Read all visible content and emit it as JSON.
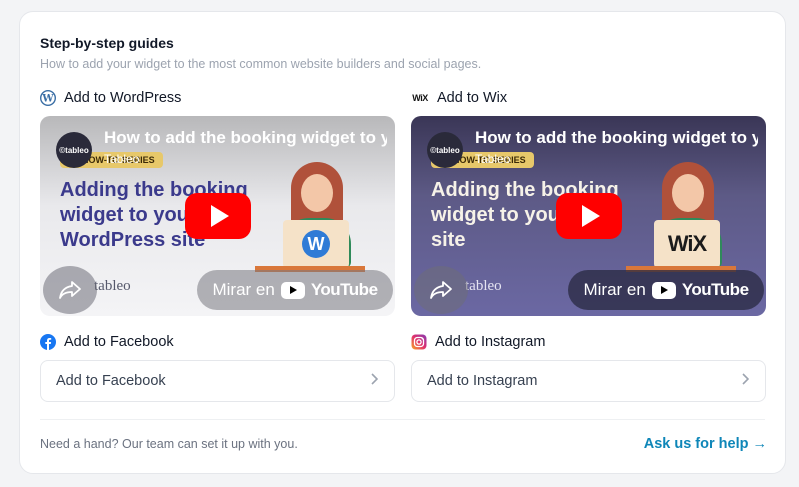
{
  "header": {
    "title": "Step-by-step guides",
    "subtitle": "How to add your widget to the most common website builders and social pages."
  },
  "guides": {
    "wordpress": {
      "label": "Add to WordPress",
      "icon": "wordpress-icon",
      "video": {
        "title": "How to add the booking widget to y",
        "channel": "Tableo",
        "channel_avatar_text": "©tableo",
        "series_badge": "HOW-TO SERIES",
        "headline": "Adding the booking widget to your WordPress site",
        "watermark": "tableo",
        "watch_label": "Mirar en",
        "youtube_word": "YouTube"
      }
    },
    "wix": {
      "label": "Add to Wix",
      "icon": "wix-icon",
      "icon_text": "WiX",
      "logo_text": "WiX",
      "video": {
        "title": "How to add the booking widget to y",
        "channel": "Tableo",
        "channel_avatar_text": "©tableo",
        "series_badge": "HOW-TO SERIES",
        "headline": "Adding the booking widget to your Wix site",
        "watermark": "tableo",
        "watch_label": "Mirar en",
        "youtube_word": "YouTube"
      }
    },
    "facebook": {
      "label": "Add to Facebook",
      "icon": "facebook-icon",
      "button_label": "Add to Facebook"
    },
    "instagram": {
      "label": "Add to Instagram",
      "icon": "instagram-icon",
      "button_label": "Add to Instagram"
    }
  },
  "footer": {
    "help_text": "Need a hand? Our team can set it up with you.",
    "help_link": "Ask us for help →"
  },
  "colors": {
    "accent_link": "#0e86b8",
    "youtube_red": "#ff0000",
    "facebook_blue": "#1877f2"
  }
}
